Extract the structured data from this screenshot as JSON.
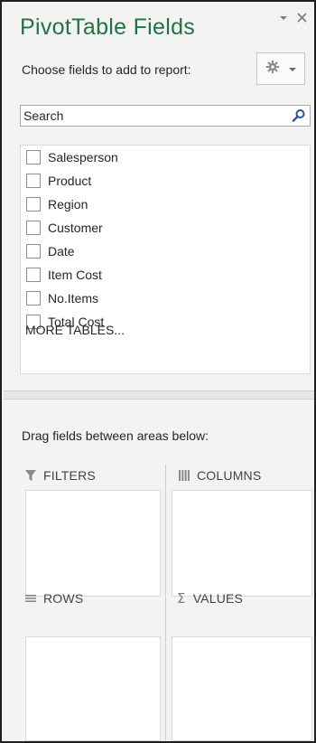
{
  "pane": {
    "title": "PivotTable Fields",
    "choose_label": "Choose fields to add to report:",
    "search_placeholder": "Search",
    "fields": [
      {
        "label": "Salesperson",
        "checked": false
      },
      {
        "label": "Product",
        "checked": false
      },
      {
        "label": "Region",
        "checked": false
      },
      {
        "label": "Customer",
        "checked": false
      },
      {
        "label": "Date",
        "checked": false
      },
      {
        "label": "Item Cost",
        "checked": false
      },
      {
        "label": "No.Items",
        "checked": false
      },
      {
        "label": "Total Cost",
        "checked": false
      }
    ],
    "more_tables": "MORE TABLES...",
    "drag_hint": "Drag fields between areas below:",
    "areas": {
      "filters": "FILTERS",
      "columns": "COLUMNS",
      "rows": "ROWS",
      "values": "VALUES"
    }
  },
  "icons": {
    "dropdown": "chevron-down-icon",
    "close": "close-icon",
    "tools": "gear-icon",
    "search": "search-icon",
    "filters": "filter-icon",
    "columns": "columns-icon",
    "rows": "rows-icon",
    "values": "sigma-icon"
  },
  "colors": {
    "accent": "#217346",
    "search_icon": "#2b5797"
  }
}
